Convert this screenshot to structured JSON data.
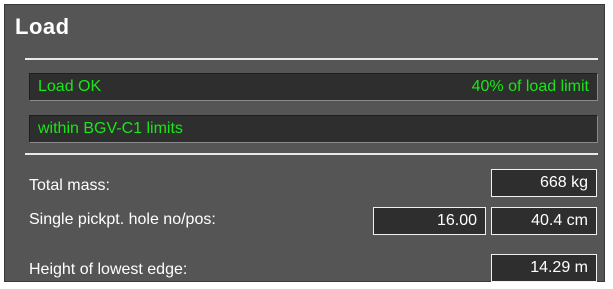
{
  "panel": {
    "title": "Load"
  },
  "status": {
    "load_state": "Load OK",
    "load_percent": "40% of load limit",
    "limits": "within BGV-C1 limits"
  },
  "fields": {
    "total_mass": {
      "label": "Total mass:",
      "value": "668 kg"
    },
    "single_pickpoint": {
      "label": "Single pickpt. hole no/pos:",
      "hole_no": "16.00",
      "position": "40.4 cm"
    },
    "lowest_edge_height": {
      "label": "Height of lowest edge:",
      "value": "14.29 m"
    }
  },
  "colors": {
    "panel_bg": "#555555",
    "status_text": "#19e619",
    "field_bg": "#2e2e2e"
  }
}
